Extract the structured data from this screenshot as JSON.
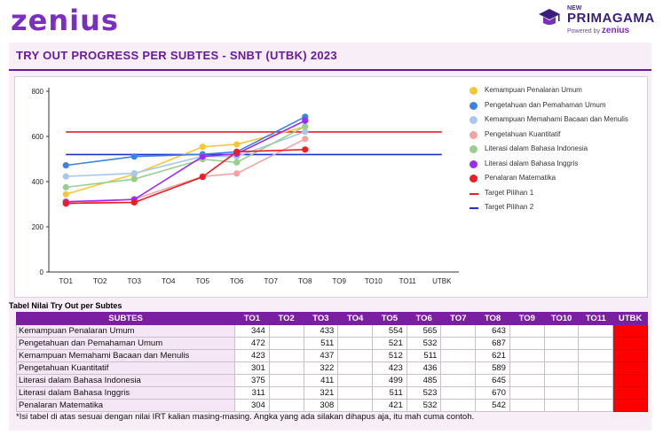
{
  "header": {
    "left_logo": "zenius",
    "right_logo_new": "NEW",
    "right_logo_brand": "PRIMAGAMA",
    "right_logo_powered": "Powered by",
    "right_logo_powered_brand": "zenius"
  },
  "title": "TRY OUT PROGRESS PER SUBTES - SNBT (UTBK) 2023",
  "chart_data": {
    "type": "line",
    "categories": [
      "TO1",
      "TO2",
      "TO3",
      "TO4",
      "TO5",
      "TO6",
      "TO7",
      "TO8",
      "TO9",
      "TO10",
      "TO11",
      "UTBK"
    ],
    "ylim": [
      0,
      800
    ],
    "yticks": [
      0,
      200,
      400,
      600,
      800
    ],
    "grid": false,
    "legend_position": "right",
    "series": [
      {
        "name": "Kemampuan Penalaran Umum",
        "color": "#f9c63b",
        "values": [
          344,
          null,
          433,
          null,
          554,
          565,
          null,
          643,
          null,
          null,
          null,
          null
        ]
      },
      {
        "name": "Pengetahuan dan Pemahaman Umum",
        "color": "#3b82e6",
        "values": [
          472,
          null,
          511,
          null,
          521,
          532,
          null,
          687,
          null,
          null,
          null,
          null
        ]
      },
      {
        "name": "Kemampuan Memahami Bacaan dan Menulis",
        "color": "#a9c7ee",
        "values": [
          423,
          null,
          437,
          null,
          512,
          511,
          null,
          621,
          null,
          null,
          null,
          null
        ]
      },
      {
        "name": "Pengetahuan Kuantitatif",
        "color": "#f4a3a3",
        "values": [
          301,
          null,
          322,
          null,
          423,
          436,
          null,
          589,
          null,
          null,
          null,
          null
        ]
      },
      {
        "name": "Literasi dalam Bahasa Indonesia",
        "color": "#98cf8e",
        "values": [
          375,
          null,
          411,
          null,
          499,
          485,
          null,
          645,
          null,
          null,
          null,
          null
        ]
      },
      {
        "name": "Literasi dalam Bahasa Inggris",
        "color": "#9b2cf2",
        "values": [
          311,
          null,
          321,
          null,
          511,
          523,
          null,
          670,
          null,
          null,
          null,
          null
        ]
      },
      {
        "name": "Penalaran Matematika",
        "color": "#ee1c24",
        "values": [
          304,
          null,
          308,
          null,
          421,
          532,
          null,
          542,
          null,
          null,
          null,
          null
        ]
      }
    ],
    "targets": [
      {
        "name": "Target Pilihan 1",
        "color": "#ee1c24",
        "value": 620
      },
      {
        "name": "Target Pilihan 2",
        "color": "#1f2fd6",
        "value": 520
      }
    ]
  },
  "table": {
    "caption": "Tabel Nilai Try Out per Subtes",
    "headers": [
      "SUBTES",
      "TO1",
      "TO2",
      "TO3",
      "TO4",
      "TO5",
      "TO6",
      "TO7",
      "TO8",
      "TO9",
      "TO10",
      "TO11",
      "UTBK"
    ],
    "rows": [
      [
        "Kemampuan Penalaran Umum",
        "344",
        "",
        "433",
        "",
        "554",
        "565",
        "",
        "643",
        "",
        "",
        "",
        ""
      ],
      [
        "Pengetahuan dan Pemahaman Umum",
        "472",
        "",
        "511",
        "",
        "521",
        "532",
        "",
        "687",
        "",
        "",
        "",
        ""
      ],
      [
        "Kemampuan Memahami Bacaan dan Menulis",
        "423",
        "",
        "437",
        "",
        "512",
        "511",
        "",
        "621",
        "",
        "",
        "",
        ""
      ],
      [
        "Pengetahuan Kuantitatif",
        "301",
        "",
        "322",
        "",
        "423",
        "436",
        "",
        "589",
        "",
        "",
        "",
        ""
      ],
      [
        "Literasi dalam Bahasa Indonesia",
        "375",
        "",
        "411",
        "",
        "499",
        "485",
        "",
        "645",
        "",
        "",
        "",
        ""
      ],
      [
        "Literasi dalam Bahasa Inggris",
        "311",
        "",
        "321",
        "",
        "511",
        "523",
        "",
        "670",
        "",
        "",
        "",
        ""
      ],
      [
        "Penalaran Matematika",
        "304",
        "",
        "308",
        "",
        "421",
        "532",
        "",
        "542",
        "",
        "",
        "",
        ""
      ]
    ]
  },
  "note": "*Isi tabel di atas sesuai dengan nilai IRT kalian masing-masing. Angka yang ada silakan dihapus aja, itu mah cuma contoh."
}
